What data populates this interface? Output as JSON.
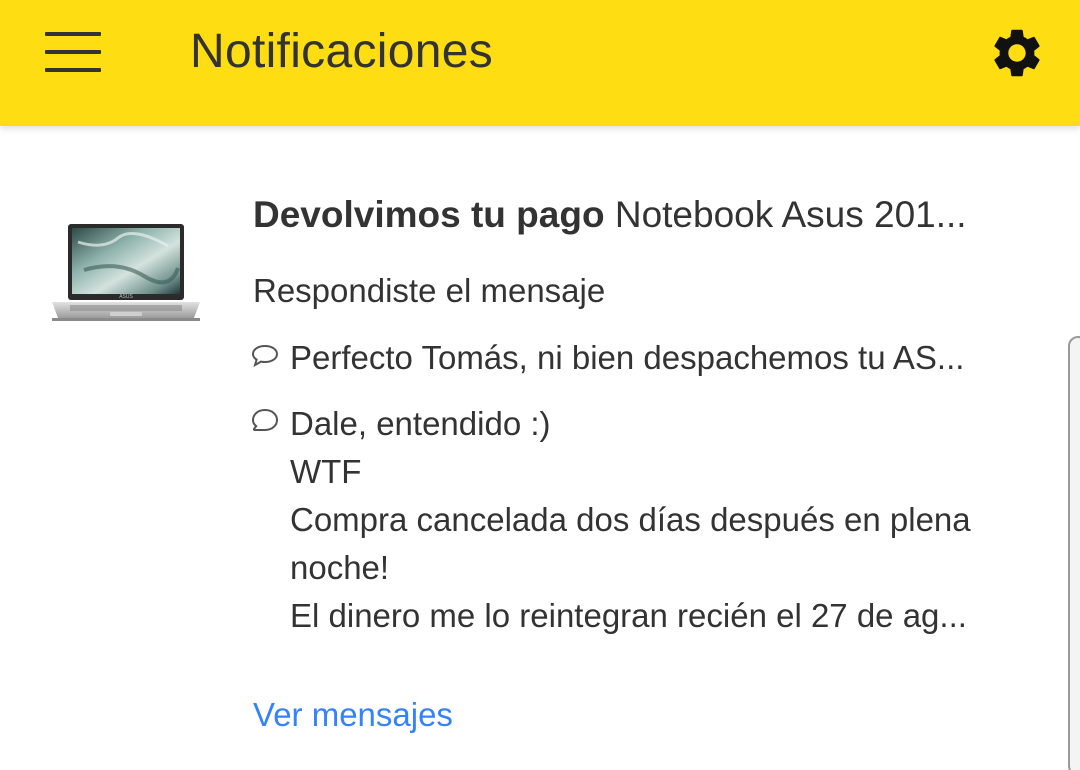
{
  "header": {
    "title": "Notificaciones",
    "menu_icon": "hamburger-menu-icon",
    "settings_icon": "gear-icon",
    "background_color": "#fede12"
  },
  "notification": {
    "title_bold": "Devolvimos tu pago",
    "title_rest": " Notebook Asus 201...",
    "subtitle": "Respondiste el mensaje",
    "image_icon": "laptop-thumbnail",
    "messages": [
      {
        "icon": "speech-bubble-icon",
        "lines": [
          "Perfecto Tomás, ni bien despachemos tu AS..."
        ]
      },
      {
        "icon": "speech-bubble-icon",
        "lines": [
          "Dale, entendido :)",
          "WTF",
          "Compra cancelada dos días después en plena noche!",
          "El dinero me lo reintegran recién el 27 de ag..."
        ]
      }
    ],
    "link_label": "Ver mensajes",
    "link_color": "#3483fa"
  }
}
